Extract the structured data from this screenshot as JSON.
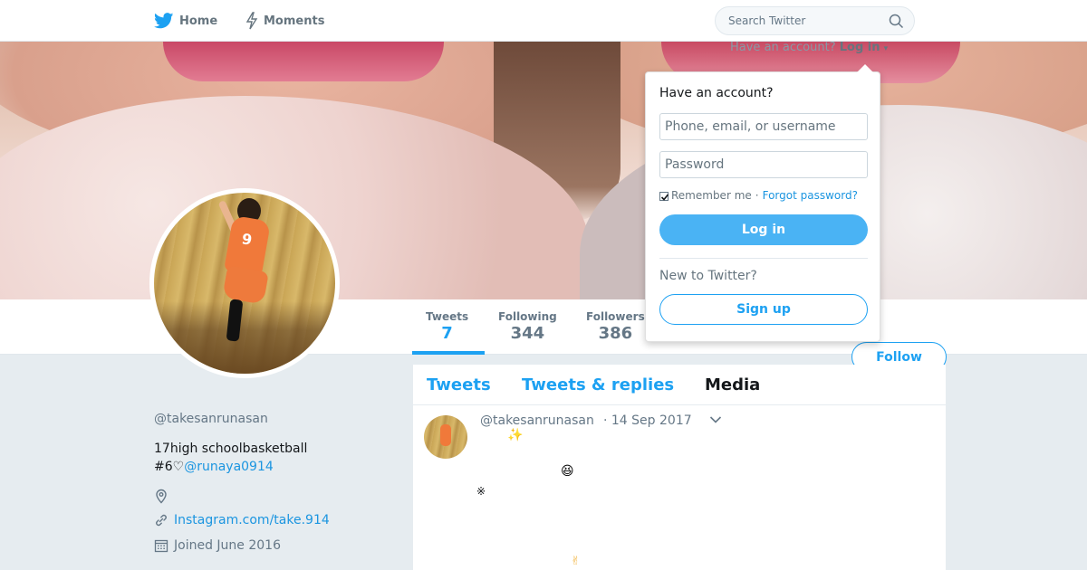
{
  "topnav": {
    "home_label": "Home",
    "moments_label": "Moments",
    "search_placeholder": "Search Twitter"
  },
  "login_hint": {
    "prefix": "Have an account?",
    "action": "Log in"
  },
  "dropdown": {
    "title": "Have an account?",
    "phone_placeholder": "Phone, email, or username",
    "password_placeholder": "Password",
    "remember_label": "Remember me",
    "separator": "·",
    "forgot_label": "Forgot password?",
    "login_button": "Log in",
    "new_label": "New to Twitter?",
    "signup_button": "Sign up"
  },
  "stats": {
    "tweets_label": "Tweets",
    "tweets_value": "7",
    "following_label": "Following",
    "following_value": "344",
    "followers_label": "Followers",
    "followers_value": "386"
  },
  "follow_button": "Follow",
  "profile": {
    "handle": "@takesanrunasan",
    "bio_line1": "17high schoolbasketball",
    "bio_line2_prefix": "#6♡",
    "bio_mention": "@runaya0914",
    "website": "Instagram.com/take.914",
    "joined": "Joined June 2016"
  },
  "timeline": {
    "tabs": [
      "Tweets",
      "Tweets & replies",
      "Media"
    ],
    "tweet": {
      "handle": "@takesanrunasan",
      "date": "· 14 Sep 2017",
      "emojis": [
        "✨",
        "😆",
        "※",
        "✌"
      ]
    }
  },
  "colors": {
    "accent": "#1da1f2",
    "text_secondary": "#657786",
    "background": "#e6ecf0"
  },
  "icons": [
    "twitter-bird-icon",
    "lightning-icon",
    "search-icon",
    "location-icon",
    "link-icon",
    "calendar-icon",
    "chevron-down-icon"
  ]
}
